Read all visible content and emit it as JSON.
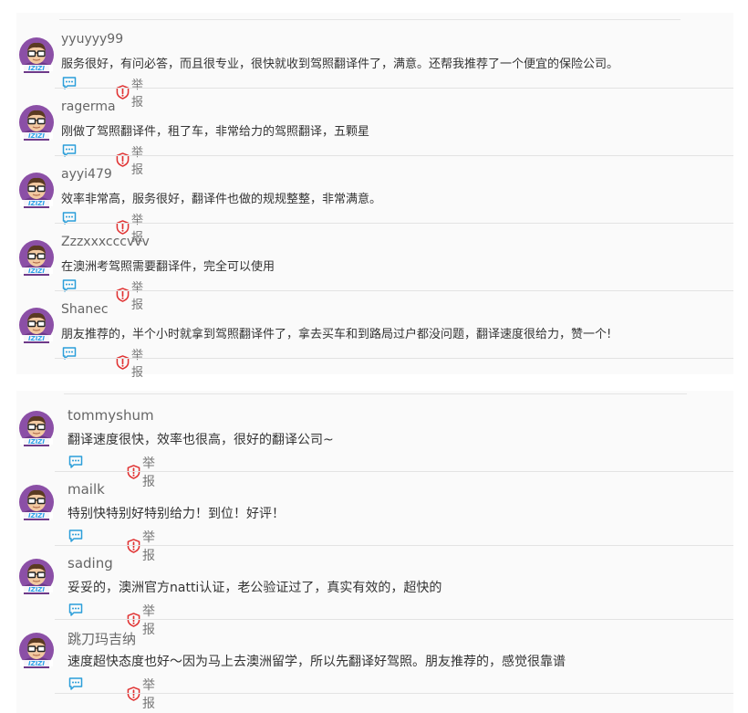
{
  "colors": {
    "accent": "#2b9ed9",
    "report": "#e03131",
    "avatar_bg": "#8b4fa6",
    "badge": "#29a0e8"
  },
  "icons": {
    "reply": "comment-bubble-icon",
    "report": "shield-exclamation-icon",
    "avatar": "glasses-cartoon-avatar"
  },
  "comment_block_1": {
    "comments": [
      {
        "username": "yyuyyy99",
        "text": "服务很好，有问必答，而且很专业，很快就收到驾照翻译件了，满意。还帮我推荐了一个便宜的保险公司。",
        "report_label": "举报",
        "badge": "IZIZI"
      },
      {
        "username": "ragerma",
        "text": "刚做了驾照翻译件，租了车，非常给力的驾照翻译，五颗星",
        "report_label": "举报",
        "badge": "IZIZI"
      },
      {
        "username": "ayyi479",
        "text": "效率非常高，服务很好，翻译件也做的规规整整，非常满意。",
        "report_label": "举报",
        "badge": "IZIZI"
      },
      {
        "username": "Zzzxxxcccvvv",
        "text": "在澳洲考驾照需要翻译件，完全可以使用",
        "report_label": "举报",
        "badge": "IZIZI"
      },
      {
        "username": "Shanec",
        "text": "朋友推荐的，半个小时就拿到驾照翻译件了，拿去买车和到路局过户都没问题，翻译速度很给力，赞一个!",
        "report_label": "举报",
        "badge": "IZIZI"
      }
    ]
  },
  "comment_block_2": {
    "comments": [
      {
        "username": "tommyshum",
        "text": "翻译速度很快，效率也很高，很好的翻译公司~",
        "report_label": "举报",
        "badge": "IZIZI"
      },
      {
        "username": "mailk",
        "text": "特别快特别好特别给力！到位！好评！",
        "report_label": "举报",
        "badge": "IZIZI"
      },
      {
        "username": "sading",
        "text": "妥妥的，澳洲官方natti认证，老公验证过了，真实有效的，超快的",
        "report_label": "举报",
        "badge": "IZIZI"
      },
      {
        "username": "跳刀玛吉纳",
        "text": "速度超快态度也好～因为马上去澳洲留学，所以先翻译好驾照。朋友推荐的，感觉很靠谱",
        "report_label": "举报",
        "badge": "IZIZI"
      }
    ]
  }
}
